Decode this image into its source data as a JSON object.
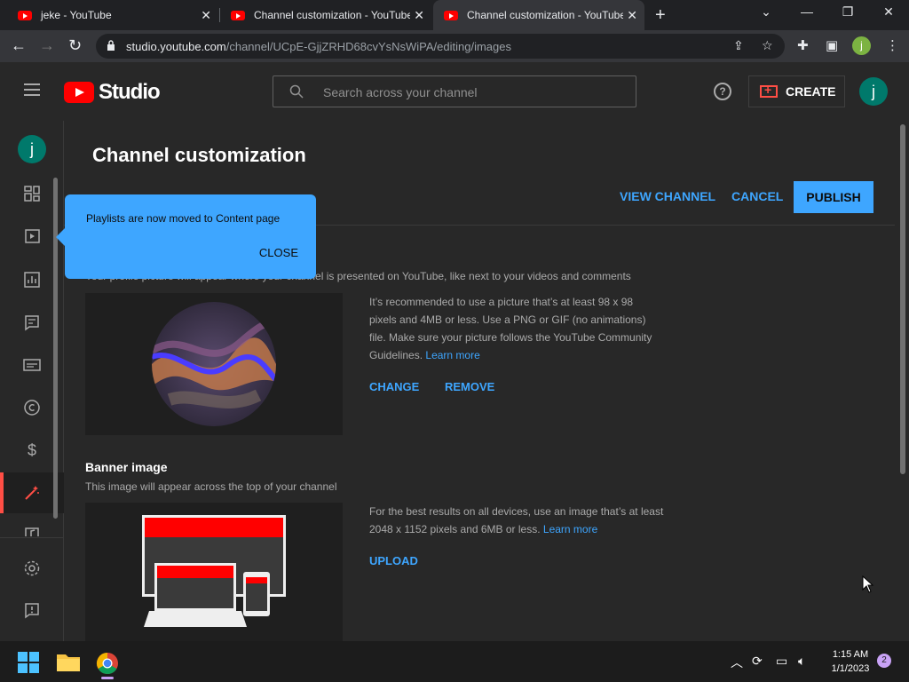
{
  "browser": {
    "tabs": [
      {
        "title": "jeke - YouTube"
      },
      {
        "title": "Channel customization - YouTube"
      },
      {
        "title": "Channel customization - YouTube"
      }
    ],
    "url_host": "studio.youtube.com",
    "url_path": "/channel/UCpE-GjjZRHD68cvYsNsWiPA/editing/images",
    "profile_initial": "j"
  },
  "header": {
    "logo_text": "Studio",
    "search_placeholder": "Search across your channel",
    "create_label": "CREATE",
    "avatar_initial": "j"
  },
  "sidebar": {
    "avatar_initial": "j",
    "items": [
      "dashboard-icon",
      "content-icon",
      "analytics-icon",
      "comments-icon",
      "subtitles-icon",
      "copyright-icon",
      "earn-icon",
      "customization-icon",
      "audio-library-icon"
    ],
    "bottom": [
      "settings-icon",
      "feedback-icon"
    ]
  },
  "main": {
    "title": "Channel customization",
    "view_channel": "VIEW CHANNEL",
    "cancel": "CANCEL",
    "publish": "PUBLISH"
  },
  "popup": {
    "message": "Playlists are now moved to Content page",
    "close": "CLOSE"
  },
  "picture": {
    "desc": "Your profile picture will appear where your channel is presented on YouTube, like next to your videos and comments",
    "info": "It’s recommended to use a picture that’s at least 98 x 98 pixels and 4MB or less. Use a PNG or GIF (no animations) file. Make sure your picture follows the YouTube Community Guidelines.",
    "learn_more": "Learn more",
    "change": "CHANGE",
    "remove": "REMOVE"
  },
  "banner": {
    "title": "Banner image",
    "desc": "This image will appear across the top of your channel",
    "info": "For the best results on all devices, use an image that’s at least 2048 x 1152 pixels and 6MB or less.",
    "learn_more": "Learn more",
    "upload": "UPLOAD"
  },
  "taskbar": {
    "time": "1:15 AM",
    "date": "1/1/2023",
    "notifications": "2"
  },
  "colors": {
    "accent": "#3ea6ff",
    "brand": "#ff0000",
    "background": "#282828"
  }
}
